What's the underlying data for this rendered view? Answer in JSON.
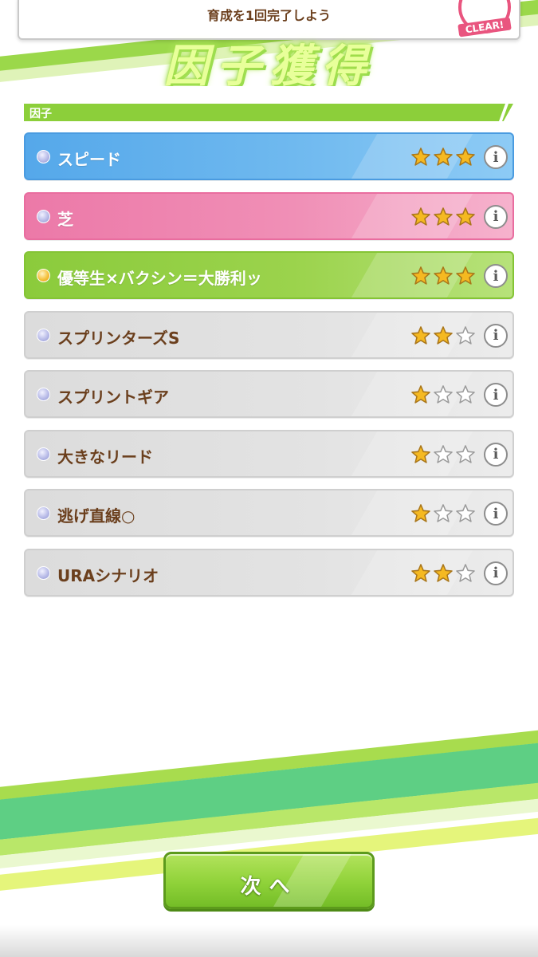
{
  "mission": {
    "text": "育成を1回完了しよう",
    "stamp": "CLEAR!"
  },
  "page_title": "因子獲得",
  "section": {
    "label": "因子"
  },
  "factors": [
    {
      "name": "スピード",
      "color": "blue",
      "dot": "silver",
      "stars": 3
    },
    {
      "name": "芝",
      "color": "pink",
      "dot": "silver",
      "stars": 3
    },
    {
      "name": "優等生×バクシン＝大勝利ッ",
      "color": "green",
      "dot": "gold",
      "stars": 3
    },
    {
      "name": "スプリンターズS",
      "color": "gray",
      "dot": "silver",
      "stars": 2
    },
    {
      "name": "スプリントギア",
      "color": "gray",
      "dot": "silver",
      "stars": 1
    },
    {
      "name": "大きなリード",
      "color": "gray",
      "dot": "silver",
      "stars": 1
    },
    {
      "name": "逃げ直線○",
      "color": "gray",
      "dot": "silver",
      "stars": 1
    },
    {
      "name": "URAシナリオ",
      "color": "gray",
      "dot": "silver",
      "stars": 2
    }
  ],
  "max_stars": 3,
  "info_icon": "i",
  "next_button": {
    "label": "次へ"
  },
  "colors": {
    "accent_green": "#8ccf3a",
    "text_brown": "#6b3f1d",
    "star_gold": "#f5b921"
  }
}
